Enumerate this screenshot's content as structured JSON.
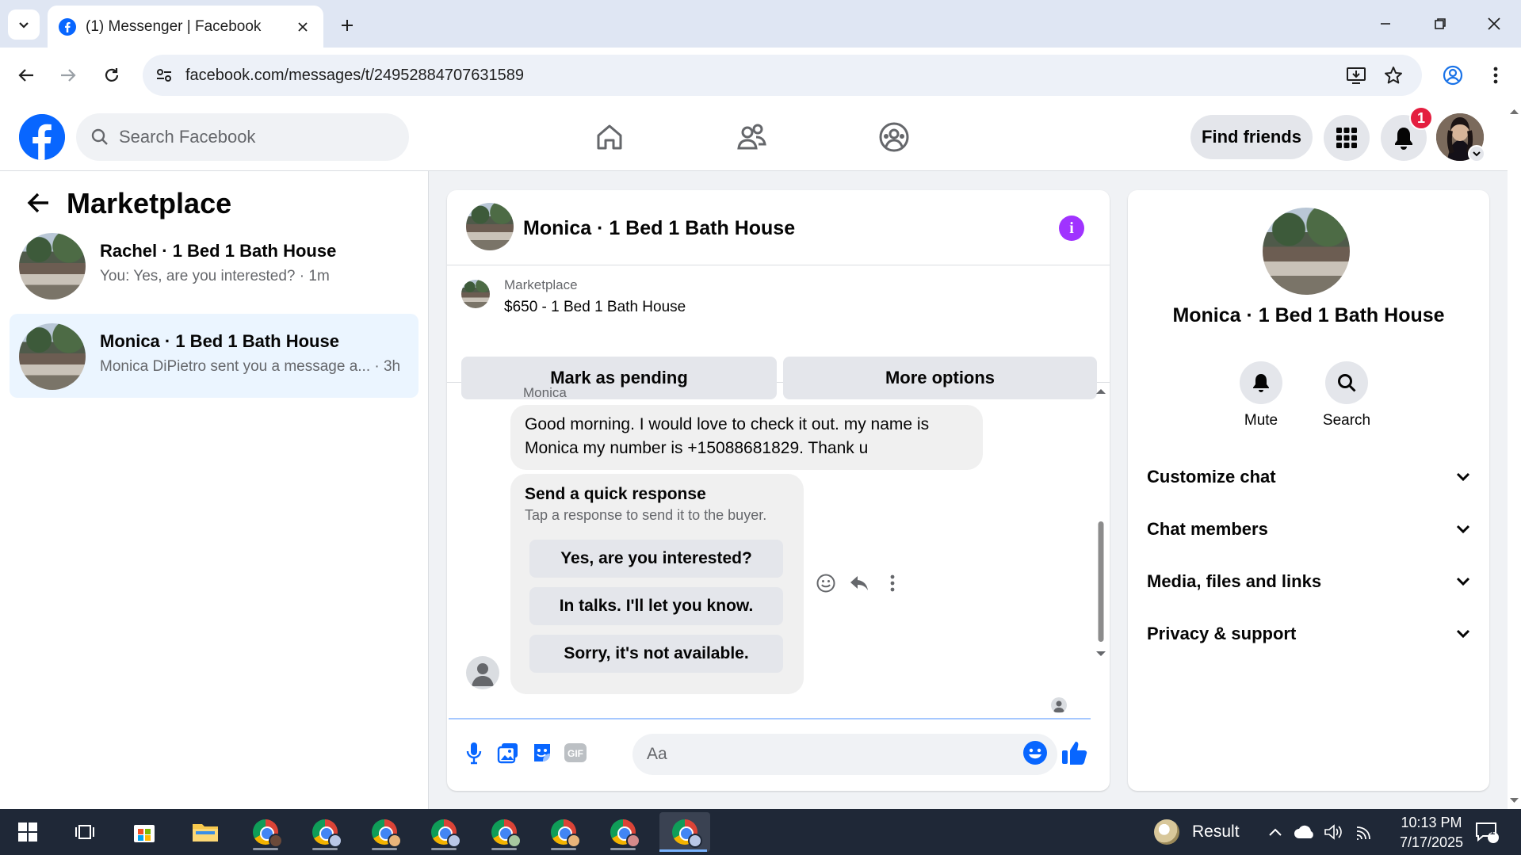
{
  "browser": {
    "tab_title": "(1) Messenger | Facebook",
    "url": "facebook.com/messages/t/24952884707631589"
  },
  "fb": {
    "search_placeholder": "Search Facebook",
    "find_friends": "Find friends",
    "notification_count": "1",
    "brand_color": "#0866ff"
  },
  "sidebar": {
    "title": "Marketplace",
    "conversations": [
      {
        "name": "Rachel · 1 Bed 1 Bath House",
        "snippet": "You: Yes, are you interested? · 1m",
        "active": false
      },
      {
        "name": "Monica · 1 Bed 1 Bath House",
        "snippet": "Monica DiPietro sent you a message a... · 3h",
        "active": true
      }
    ]
  },
  "chat": {
    "title": "Monica · 1 Bed 1 Bath House",
    "listing_source": "Marketplace",
    "listing_price": "$650 - 1 Bed 1 Bath House",
    "mark_pending": "Mark as pending",
    "more_options": "More options",
    "sender": "Monica",
    "message": "Good morning. I would love to check it out. my name is Monica my number is +15088681829. Thank u",
    "quick_title": "Send a quick response",
    "quick_sub": "Tap a response to send it to the buyer.",
    "quick_responses": [
      "Yes, are you interested?",
      "In talks. I'll let you know.",
      "Sorry, it's not available."
    ],
    "input_placeholder": "Aa"
  },
  "details": {
    "name": "Monica · 1 Bed 1 Bath House",
    "mute": "Mute",
    "search": "Search",
    "sections": [
      "Customize chat",
      "Chat members",
      "Media, files and links",
      "Privacy & support"
    ]
  },
  "taskbar": {
    "result_label": "Result",
    "time": "10:13 PM",
    "date": "7/17/2025",
    "notification_count": "1"
  }
}
